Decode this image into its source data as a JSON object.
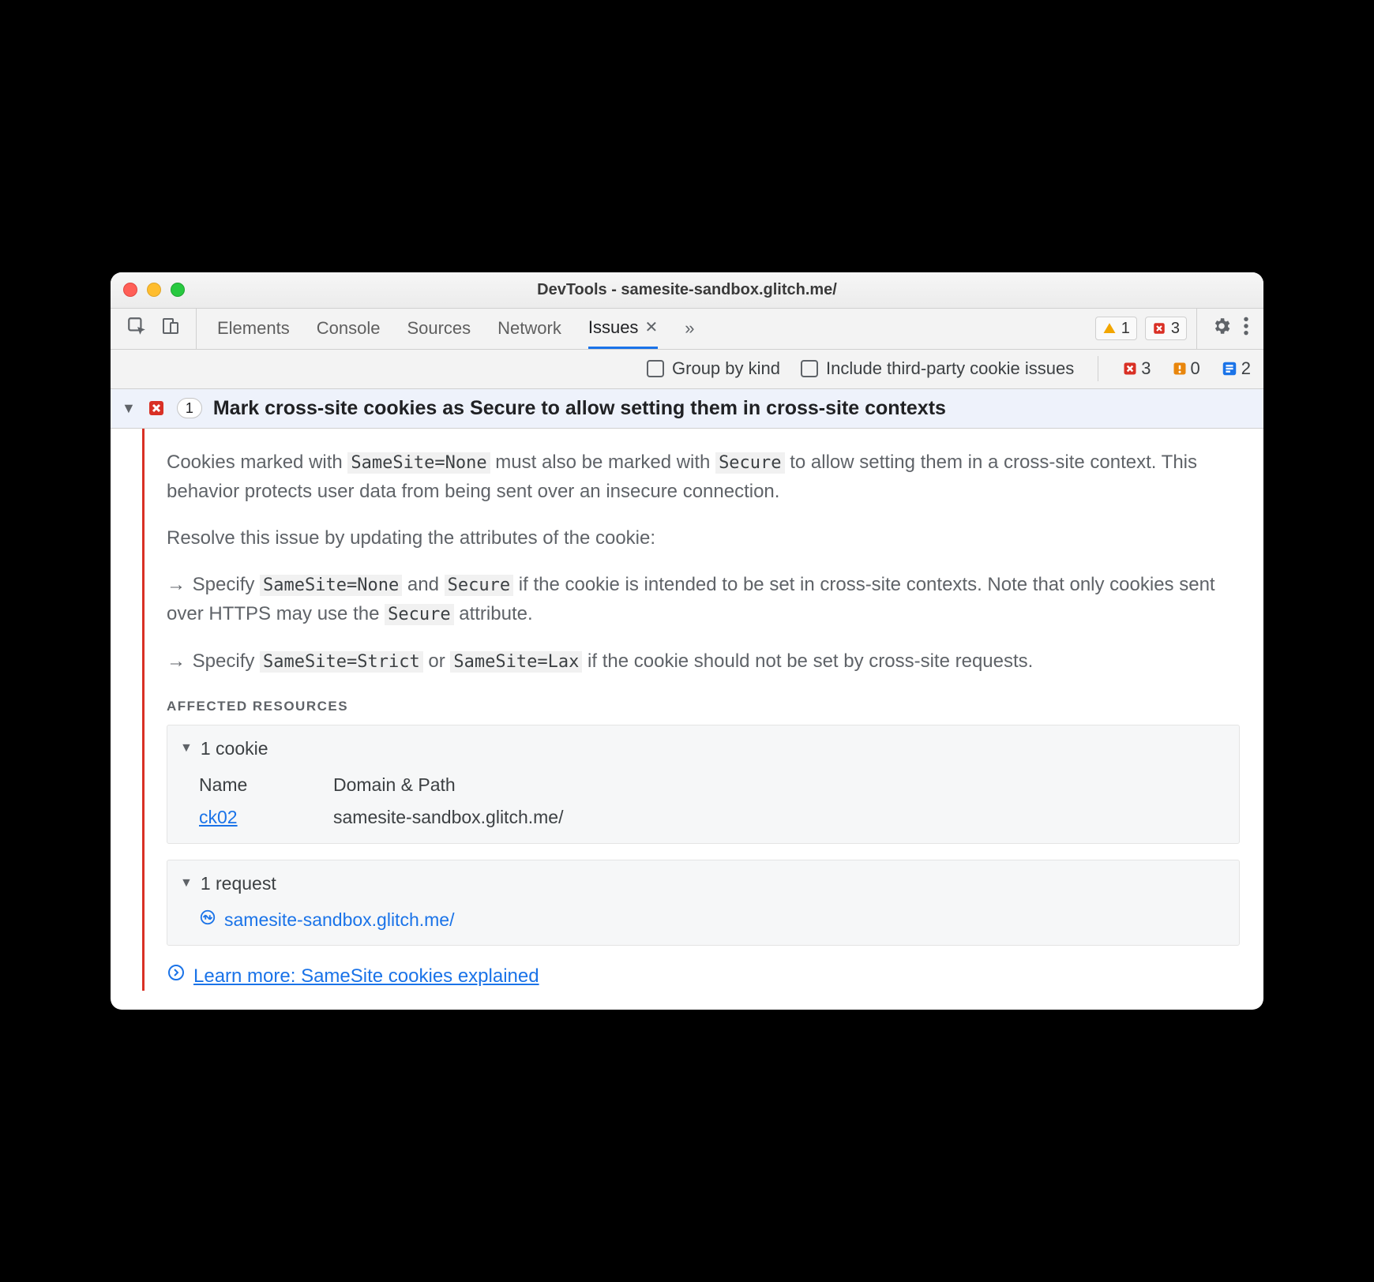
{
  "title": "DevTools - samesite-sandbox.glitch.me/",
  "tabs": [
    "Elements",
    "Console",
    "Sources",
    "Network",
    "Issues"
  ],
  "top_badges": {
    "warning": "1",
    "error": "3"
  },
  "filter": {
    "group_by_kind": "Group by kind",
    "include_thirdparty": "Include third-party cookie issues",
    "counters": {
      "error": "3",
      "warning": "0",
      "info": "2"
    }
  },
  "issue": {
    "count": "1",
    "title": "Mark cross-site cookies as Secure to allow setting them in cross-site contexts",
    "para1_a": "Cookies marked with ",
    "para1_code1": "SameSite=None",
    "para1_b": " must also be marked with ",
    "para1_code2": "Secure",
    "para1_c": " to allow setting them in a cross-site context. This behavior protects user data from being sent over an insecure connection.",
    "para2": "Resolve this issue by updating the attributes of the cookie:",
    "bullet1_a": "Specify ",
    "bullet1_code1": "SameSite=None",
    "bullet1_b": " and ",
    "bullet1_code2": "Secure",
    "bullet1_c": " if the cookie is intended to be set in cross-site contexts. Note that only cookies sent over HTTPS may use the ",
    "bullet1_code3": "Secure",
    "bullet1_d": " attribute.",
    "bullet2_a": "Specify ",
    "bullet2_code1": "SameSite=Strict",
    "bullet2_b": " or ",
    "bullet2_code2": "SameSite=Lax",
    "bullet2_c": " if the cookie should not be set by cross-site requests.",
    "affected_heading": "AFFECTED RESOURCES",
    "cookie_head": "1 cookie",
    "cookie_cols": {
      "name": "Name",
      "domain": "Domain & Path"
    },
    "cookie_row": {
      "name": "ck02",
      "domain": "samesite-sandbox.glitch.me/"
    },
    "request_head": "1 request",
    "request_row": "samesite-sandbox.glitch.me/",
    "learn_more": "Learn more: SameSite cookies explained"
  }
}
